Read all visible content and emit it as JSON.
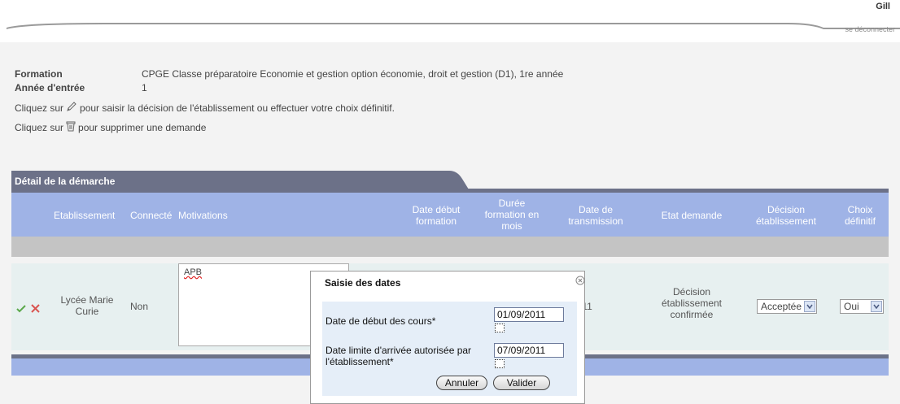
{
  "header": {
    "user": "Gill",
    "logout": "se déconnecter"
  },
  "info": {
    "formation_label": "Formation",
    "formation_value": "CPGE Classe préparatoire Economie et gestion option économie, droit et gestion (D1), 1re année",
    "annee_label": "Année d'entrée",
    "annee_value": "1",
    "hint1_before": "Cliquez sur",
    "hint1_after": "pour saisir la décision de l'établissement ou effectuer votre choix définitif.",
    "hint2_before": "Cliquez sur",
    "hint2_after": "pour supprimer une demande"
  },
  "section": {
    "title": "Détail de la démarche"
  },
  "table": {
    "headers": {
      "etablissement": "Etablissement",
      "connecte": "Connecté",
      "motivations": "Motivations",
      "date_debut_1": "Date début",
      "date_debut_2": "formation",
      "duree_1": "Durée",
      "duree_2": "formation en",
      "duree_3": "mois",
      "transmission_1": "Date de",
      "transmission_2": "transmission",
      "etat": "Etat demande",
      "decision_1": "Décision",
      "decision_2": "établissement",
      "choix_1": "Choix",
      "choix_2": "définitif"
    },
    "row": {
      "etab_1": "Lycée Marie",
      "etab_2": "Curie",
      "connecte": "Non",
      "motivation": "APB",
      "transmission_partial": "4/2011",
      "etat_1": "Décision",
      "etat_2": "établissement",
      "etat_3": "confirmée",
      "decision": "Acceptée",
      "choix": "Oui"
    }
  },
  "dialog": {
    "title": "Saisie des dates",
    "debut_label": "Date de début des cours*",
    "debut_value": "01/09/2011",
    "limite_label_1": "Date limite d'arrivée autorisée par",
    "limite_label_2": "l'établissement*",
    "limite_value": "07/09/2011",
    "cancel": "Annuler",
    "validate": "Valider"
  },
  "colors": {
    "header_blue": "#9fb3e6",
    "band_dark": "#6c7188",
    "row_bg": "#e7f0f0"
  }
}
